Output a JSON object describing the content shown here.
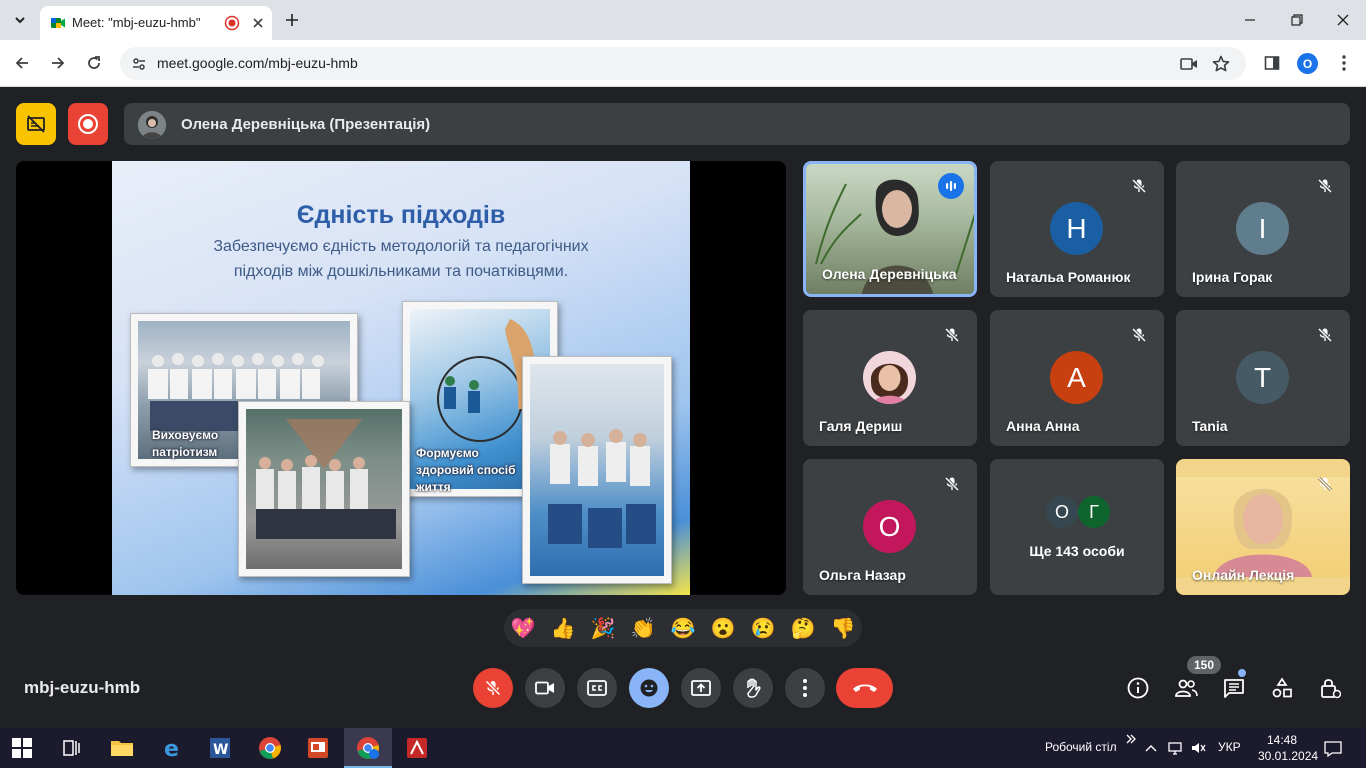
{
  "browser": {
    "tab_title": "Meet: \"mbj-euzu-hmb\"",
    "url": "meet.google.com/mbj-euzu-hmb",
    "profile_initial": "O"
  },
  "header": {
    "presenter_label": "Олена Деревніцька (Презентація)"
  },
  "slide": {
    "title": "Єдність підходів",
    "subtitle_line1": "Забезпечуємо єдність методологій та педагогічних",
    "subtitle_line2": "підходів між дошкільниками та початківцями.",
    "caption_left_1": "Виховуємо",
    "caption_left_2": "патріотизм",
    "caption_mid_1": "Формуємо",
    "caption_mid_2": "здоровий спосіб",
    "caption_mid_3": "життя"
  },
  "participants": [
    {
      "name": "Олена Деревніцька",
      "initial": "",
      "color": ""
    },
    {
      "name": "Натальа Романюк",
      "initial": "Н",
      "color": "#1a5fa3"
    },
    {
      "name": "Ірина Горак",
      "initial": "І",
      "color": "#5f7d8c"
    },
    {
      "name": "Галя Дериш",
      "initial": "",
      "color": ""
    },
    {
      "name": "Анна Анна",
      "initial": "А",
      "color": "#c8400f"
    },
    {
      "name": "Tania",
      "initial": "T",
      "color": "#455a64"
    },
    {
      "name": "Ольга Назар",
      "initial": "О",
      "color": "#c2185b"
    },
    {
      "name": "Ще 143 особи",
      "initial_a": "О",
      "initial_b": "Г",
      "color_a": "#37474f",
      "color_b": "#0d652d"
    },
    {
      "name": "Онлайн Лекція",
      "initial": "",
      "color": ""
    }
  ],
  "reactions": [
    "💖",
    "👍",
    "🎉",
    "👏",
    "😂",
    "😮",
    "😢",
    "🤔",
    "👎"
  ],
  "bottom_bar": {
    "meeting_code": "mbj-euzu-hmb",
    "participant_count": "150"
  },
  "taskbar": {
    "desktop_label": "Робочий стіл",
    "language": "УКР",
    "time": "14:48",
    "date": "30.01.2024"
  },
  "colors": {
    "accent": "#8ab4f8",
    "danger": "#ea4335",
    "surface": "#3c4043",
    "background": "#202124"
  }
}
